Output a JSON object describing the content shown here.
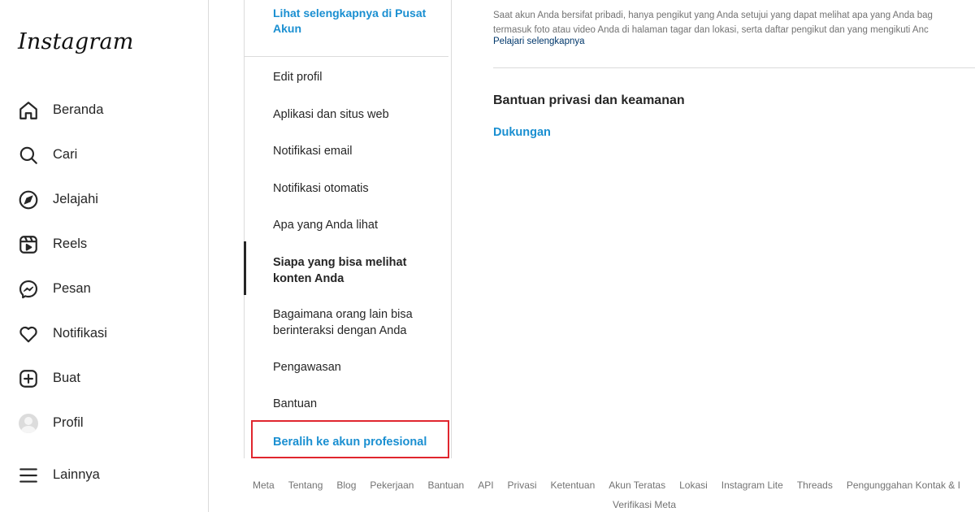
{
  "nav": {
    "logo": "Instagram",
    "items": [
      {
        "label": "Beranda",
        "icon": "home-icon"
      },
      {
        "label": "Cari",
        "icon": "search-icon"
      },
      {
        "label": "Jelajahi",
        "icon": "compass-icon"
      },
      {
        "label": "Reels",
        "icon": "reels-icon"
      },
      {
        "label": "Pesan",
        "icon": "messenger-icon"
      },
      {
        "label": "Notifikasi",
        "icon": "heart-icon"
      },
      {
        "label": "Buat",
        "icon": "plus-square-icon"
      },
      {
        "label": "Profil",
        "icon": "avatar"
      },
      {
        "label": "Lainnya",
        "icon": "menu-icon"
      }
    ]
  },
  "settings_menu": {
    "accounts_center_link": "Lihat selengkapnya di Pusat Akun",
    "items": [
      "Edit profil",
      "Aplikasi dan situs web",
      "Notifikasi email",
      "Notifikasi otomatis",
      "Apa yang Anda lihat",
      "Siapa yang bisa melihat konten Anda",
      "Bagaimana orang lain bisa berinteraksi dengan Anda",
      "Pengawasan",
      "Bantuan",
      "Beralih ke akun profesional"
    ],
    "active_item": "Siapa yang bisa melihat konten Anda"
  },
  "main": {
    "description_line1": "Saat akun Anda bersifat pribadi, hanya pengikut yang Anda setujui yang dapat melihat apa yang Anda bag",
    "description_line2": "termasuk foto atau video Anda di halaman tagar dan lokasi, serta daftar pengikut dan yang mengikuti Anc",
    "learn_more": "Pelajari selengkapnya",
    "section_title": "Bantuan privasi dan keamanan",
    "support_link": "Dukungan"
  },
  "footer": {
    "links": [
      "Meta",
      "Tentang",
      "Blog",
      "Pekerjaan",
      "Bantuan",
      "API",
      "Privasi",
      "Ketentuan",
      "Akun Teratas",
      "Lokasi",
      "Instagram Lite",
      "Threads",
      "Pengunggahan Kontak & I"
    ],
    "meta_verified": "Verifikasi Meta"
  },
  "colors": {
    "link_blue": "#1a8fd1",
    "highlight_red": "#e0262e",
    "text": "#262626",
    "muted": "#737373",
    "border": "#dbdbdb"
  }
}
